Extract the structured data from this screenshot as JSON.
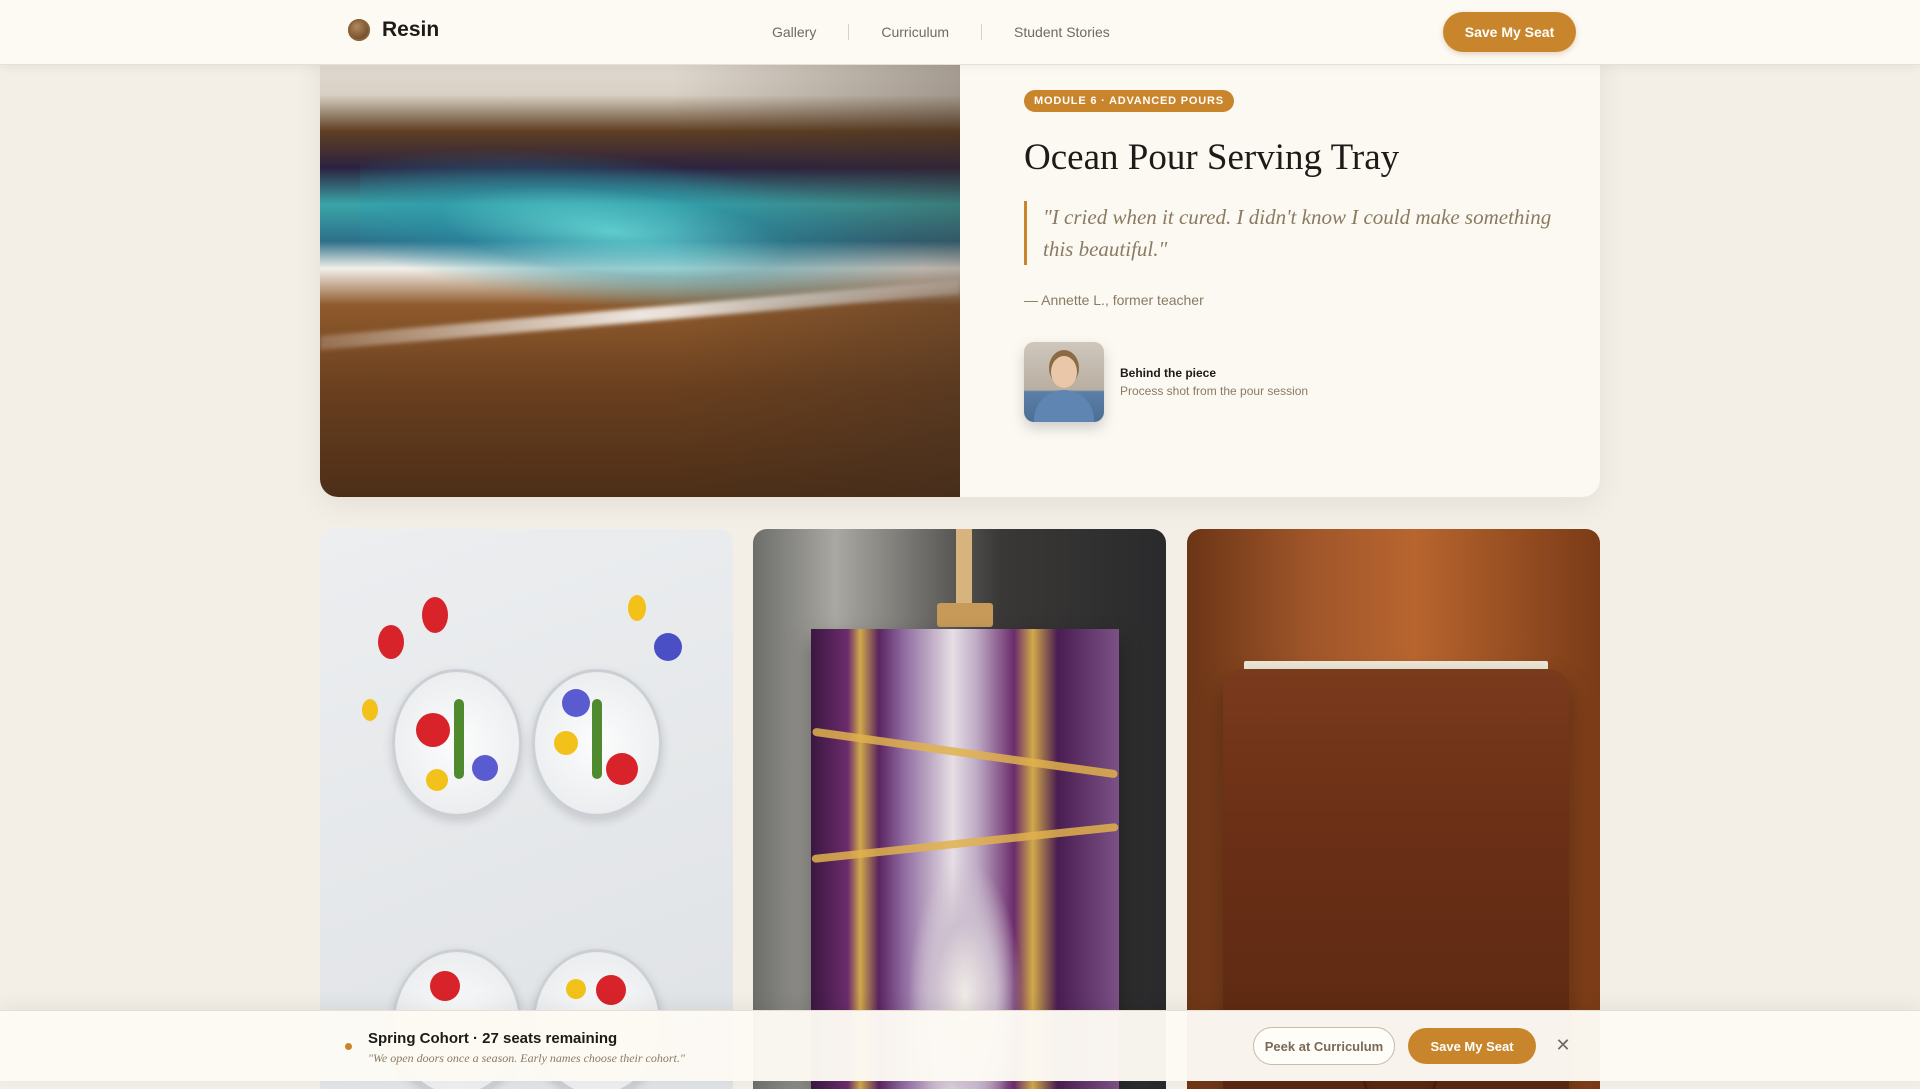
{
  "header": {
    "brand": {
      "name": "Resin",
      "logo_icon": "resin-drop-logo-icon"
    },
    "nav": [
      {
        "label": "Gallery"
      },
      {
        "label": "Curriculum"
      },
      {
        "label": "Student Stories"
      }
    ],
    "cta_label": "Save My Seat"
  },
  "feature": {
    "badge": "MODULE 6 · ADVANCED POURS",
    "title": "Ocean Pour Serving Tray",
    "quote": "\"I cried when it cured. I didn't know I could make something this beautiful.\"",
    "attribution": "— Annette L., former teacher",
    "behind": {
      "label": "Behind the piece",
      "caption": "Process shot from the pour session"
    }
  },
  "gallery": [
    {
      "name": "pressed-flower-coasters"
    },
    {
      "name": "geode-wall-art"
    },
    {
      "name": "leather-embossed-piece"
    }
  ],
  "cohort_bar": {
    "title": "Spring Cohort · 27 seats remaining",
    "subtitle": "\"We open doors once a season. Early names choose their cohort.\"",
    "secondary_label": "Peek at Curriculum",
    "primary_label": "Save My Seat",
    "close_icon": "close-icon"
  },
  "colors": {
    "accent": "#c9852c",
    "background": "#f3efe7",
    "surface": "#fcf9f3",
    "muted_text": "#8a7a62"
  }
}
